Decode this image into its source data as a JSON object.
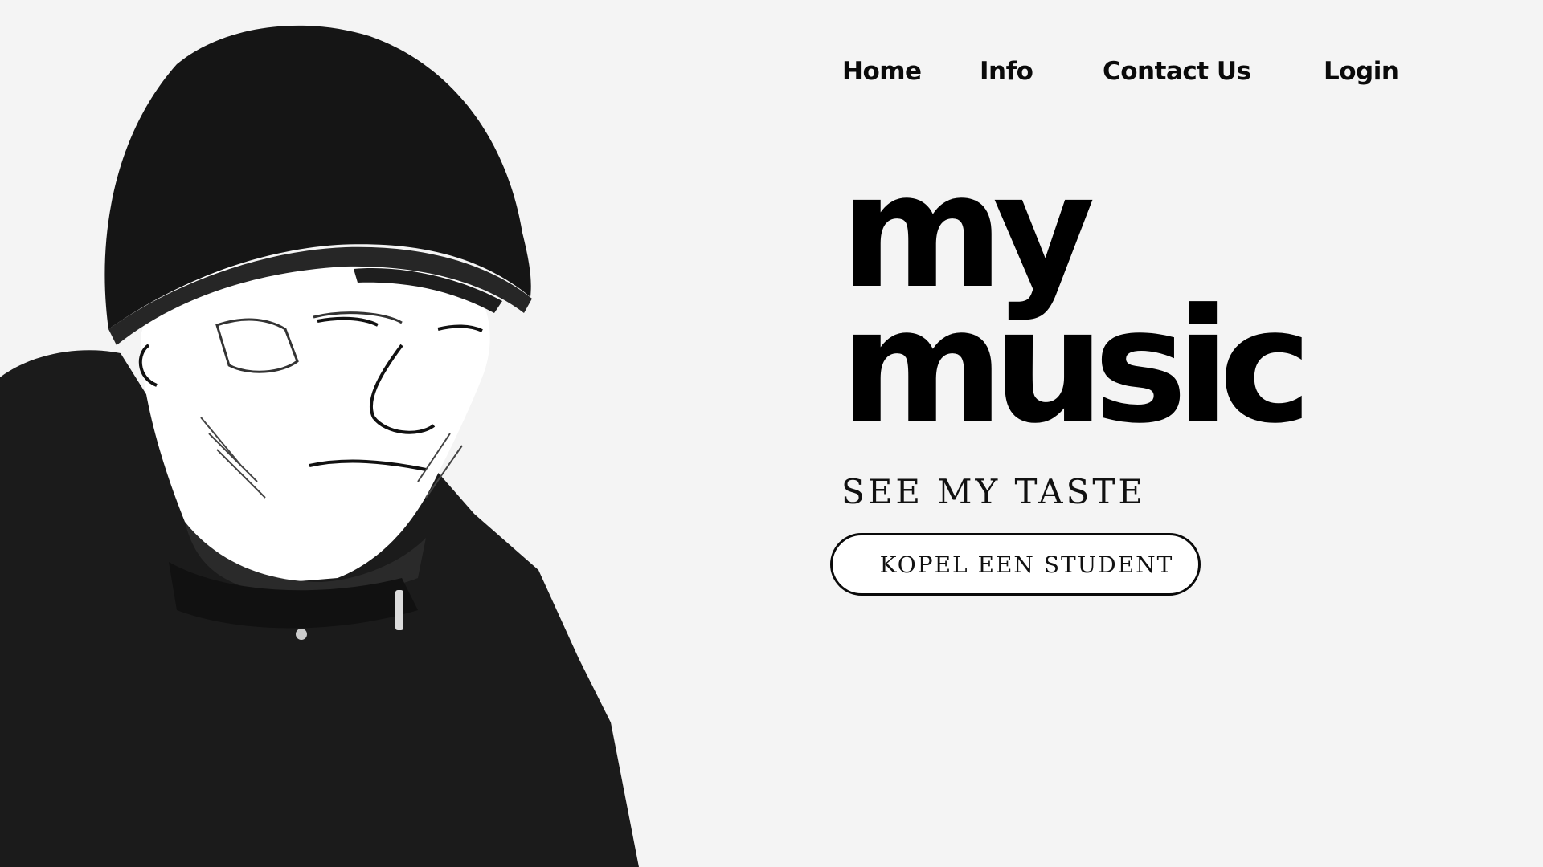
{
  "colors": {
    "background": "#f4f4f4",
    "text": "#000000",
    "button_background": "#ffffff",
    "button_border": "#0a0a0a",
    "illustration_dark": "#1b1b1b"
  },
  "illustration": {
    "icon": "person-in-beanie-illustration",
    "description": ""
  },
  "nav": {
    "items": [
      {
        "label": "Home"
      },
      {
        "label": "Info"
      },
      {
        "label": "Contact Us"
      },
      {
        "label": "Login"
      }
    ]
  },
  "hero": {
    "title_line1": "my",
    "title_line2": "music",
    "tagline": "SEE MY TASTE",
    "cta_label": "KOPEL EEN STUDENT"
  }
}
